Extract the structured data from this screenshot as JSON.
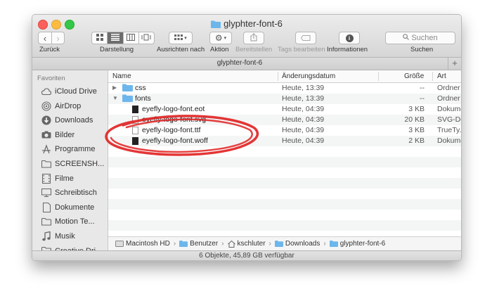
{
  "window": {
    "title": "glyphter-font-6"
  },
  "toolbar": {
    "back_label": "Zurück",
    "view_label": "Darstellung",
    "arrange_label": "Ausrichten nach",
    "action_label": "Aktion",
    "share_label": "Bereitstellen",
    "tags_label": "Tags bearbeiten",
    "info_label": "Informationen",
    "search_label": "Suchen",
    "search_placeholder": "Suchen"
  },
  "tabbar": {
    "label": "glyphter-font-6",
    "plus": "+"
  },
  "sidebar": {
    "header": "Favoriten",
    "items": [
      {
        "label": "iCloud Drive",
        "icon": "cloud-icon"
      },
      {
        "label": "AirDrop",
        "icon": "airdrop-icon"
      },
      {
        "label": "Downloads",
        "icon": "downloads-icon"
      },
      {
        "label": "Bilder",
        "icon": "camera-icon"
      },
      {
        "label": "Programme",
        "icon": "apps-icon"
      },
      {
        "label": "SCREENSH...",
        "icon": "folder-icon"
      },
      {
        "label": "Filme",
        "icon": "film-icon"
      },
      {
        "label": "Schreibtisch",
        "icon": "desktop-icon"
      },
      {
        "label": "Dokumente",
        "icon": "document-icon"
      },
      {
        "label": "Motion Te...",
        "icon": "folder-icon"
      },
      {
        "label": "Musik",
        "icon": "music-icon"
      },
      {
        "label": "Creative Dri...",
        "icon": "folder-icon"
      }
    ]
  },
  "columns": {
    "name": "Name",
    "date": "Änderungsdatum",
    "size": "Größe",
    "kind": "Art"
  },
  "files": [
    {
      "name": "css",
      "date": "Heute, 13:39",
      "size": "--",
      "kind": "Ordner",
      "type": "folder",
      "disclosure": "▶",
      "indent": 0
    },
    {
      "name": "fonts",
      "date": "Heute, 13:39",
      "size": "--",
      "kind": "Ordner",
      "type": "folder",
      "disclosure": "▼",
      "indent": 0
    },
    {
      "name": "eyefly-logo-font.eot",
      "date": "Heute, 04:39",
      "size": "3 KB",
      "kind": "Dokume",
      "type": "file-dark",
      "disclosure": "",
      "indent": 1
    },
    {
      "name": "eyefly-logo-font.svg",
      "date": "Heute, 04:39",
      "size": "20 KB",
      "kind": "SVG-Do",
      "type": "file",
      "disclosure": "",
      "indent": 1
    },
    {
      "name": "eyefly-logo-font.ttf",
      "date": "Heute, 04:39",
      "size": "3 KB",
      "kind": "TrueTy...",
      "type": "file",
      "disclosure": "",
      "indent": 1
    },
    {
      "name": "eyefly-logo-font.woff",
      "date": "Heute, 04:39",
      "size": "2 KB",
      "kind": "Dokume",
      "type": "file-dark",
      "disclosure": "",
      "indent": 1
    }
  ],
  "pathbar": [
    "Macintosh HD",
    "Benutzer",
    "kschluter",
    "Downloads",
    "glyphter-font-6"
  ],
  "status": "6 Objekte, 45,89 GB verfügbar",
  "colors": {
    "annotation": "#e02020",
    "folder": "#6cb6ec",
    "selection": "#6d6d6d"
  }
}
